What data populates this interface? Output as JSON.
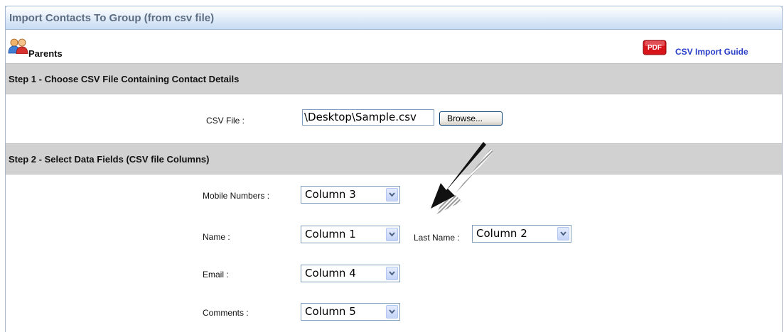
{
  "window": {
    "title": "Import Contacts To Group (from csv file)"
  },
  "group": {
    "name": "Parents",
    "icon": "users-icon"
  },
  "guide": {
    "link_label": "CSV Import Guide",
    "icon": "pdf-icon",
    "icon_text": "PDF"
  },
  "step1": {
    "title": "Step 1 - Choose CSV File Containing Contact Details",
    "csv_file_label": "CSV File :",
    "csv_file_value": "\\Desktop\\Sample.csv",
    "browse_label": "Browse..."
  },
  "step2": {
    "title": "Step 2 - Select Data Fields (CSV file Columns)",
    "fields": {
      "mobile": {
        "label": "Mobile Numbers :",
        "value": "Column 3"
      },
      "name": {
        "label": "Name :",
        "value": "Column 1"
      },
      "last_name": {
        "label": "Last Name :",
        "value": "Column 2"
      },
      "email": {
        "label": "Email :",
        "value": "Column 4"
      },
      "comments": {
        "label": "Comments :",
        "value": "Column 5"
      }
    }
  },
  "colors": {
    "title_text": "#5c6d82",
    "step_bar": "#d1d1d1",
    "link": "#2a3fc8",
    "pdf_red": "#d8141b"
  }
}
